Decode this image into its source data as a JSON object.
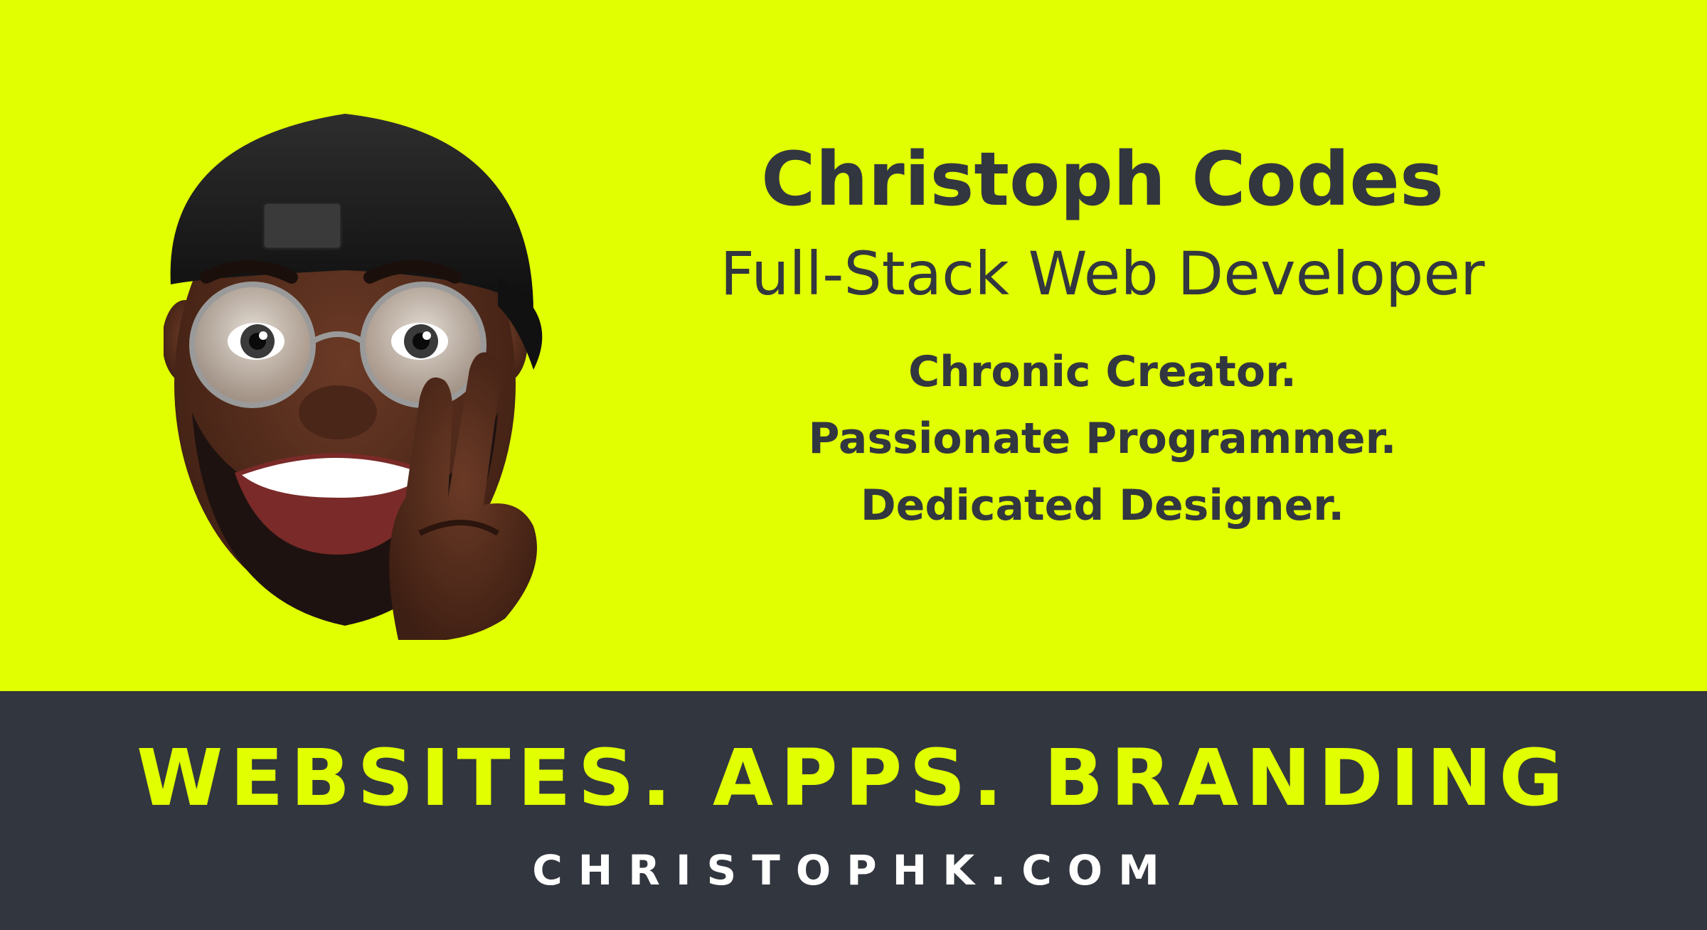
{
  "colors": {
    "accent": "#e1ff00",
    "dark": "#32363f",
    "white": "#ffffff"
  },
  "hero": {
    "title": "Christoph Codes",
    "subtitle": "Full-Stack Web Developer",
    "taglines": [
      "Chronic Creator.",
      "Passionate Programmer.",
      "Dedicated Designer."
    ]
  },
  "footer": {
    "headline": "WEBSITES. APPS. BRANDING",
    "website": "CHRISTOPHK.COM"
  },
  "avatar": {
    "icon": "memoji-peace-sign-icon"
  }
}
